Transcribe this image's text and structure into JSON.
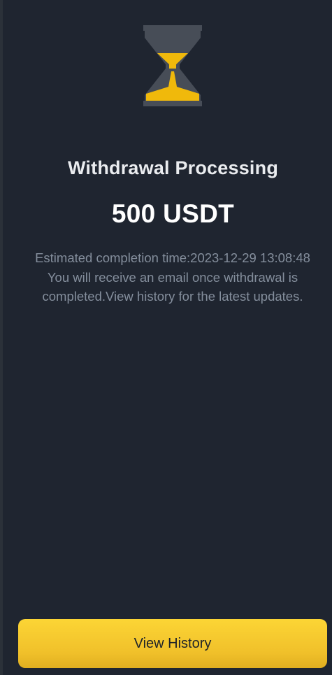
{
  "status": {
    "icon": "hourglass-icon",
    "title": "Withdrawal Processing",
    "amount": "500 USDT"
  },
  "details": {
    "estimated_completion": "Estimated completion time:2023-12-29 13:08:48",
    "notice_line_1": "You will receive an email once withdrawal is",
    "notice_line_2": "completed.View history for the latest updates."
  },
  "actions": {
    "view_history_label": "View History"
  },
  "colors": {
    "background": "#1f2530",
    "accent": "#fcd535",
    "hourglass_frame": "#474d57",
    "text_primary": "#eaecef",
    "text_secondary": "#848e9c"
  }
}
